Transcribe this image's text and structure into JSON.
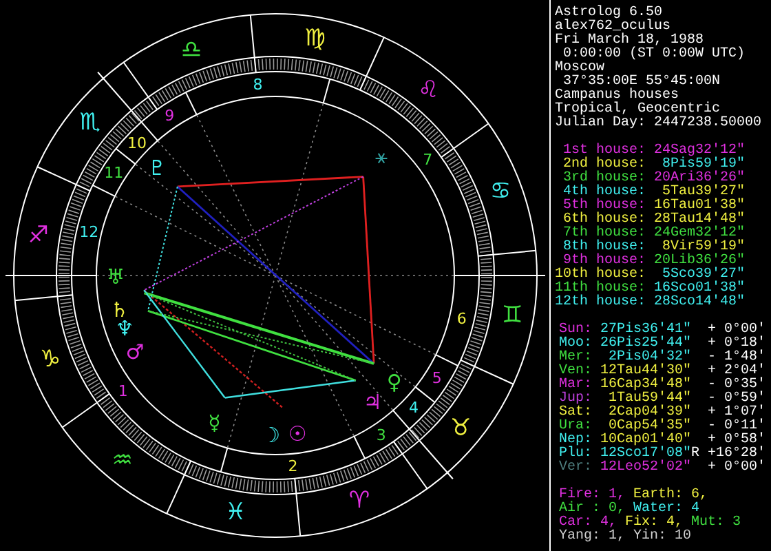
{
  "chart": {
    "signs": [
      {
        "glyph": "♈",
        "color": "#e030e0"
      },
      {
        "glyph": "♉",
        "color": "#f0f040"
      },
      {
        "glyph": "♊",
        "color": "#40e040"
      },
      {
        "glyph": "♋",
        "color": "#40f0f0"
      },
      {
        "glyph": "♌",
        "color": "#e030e0"
      },
      {
        "glyph": "♍",
        "color": "#f0f040"
      },
      {
        "glyph": "♎",
        "color": "#40e040"
      },
      {
        "glyph": "♏",
        "color": "#40f0f0"
      },
      {
        "glyph": "♐",
        "color": "#e030e0"
      },
      {
        "glyph": "♑",
        "color": "#f0f040"
      },
      {
        "glyph": "♒",
        "color": "#40e040"
      },
      {
        "glyph": "♓",
        "color": "#40f0f0"
      }
    ],
    "house_numbers": [
      {
        "text": "1",
        "color": "#e030e0"
      },
      {
        "text": "2",
        "color": "#f0f040"
      },
      {
        "text": "3",
        "color": "#40e040"
      },
      {
        "text": "4",
        "color": "#40f0f0"
      },
      {
        "text": "5",
        "color": "#e030e0"
      },
      {
        "text": "6",
        "color": "#f0f040"
      },
      {
        "text": "7",
        "color": "#40e040"
      },
      {
        "text": "8",
        "color": "#40f0f0"
      },
      {
        "text": "9",
        "color": "#e030e0"
      },
      {
        "text": "10",
        "color": "#f0f040"
      },
      {
        "text": "11",
        "color": "#40e040"
      },
      {
        "text": "12",
        "color": "#40f0f0"
      }
    ],
    "planets": [
      {
        "glyph": "☽",
        "color": "#40f0f0"
      },
      {
        "glyph": "☉",
        "color": "#e030e0"
      },
      {
        "glyph": "☿",
        "color": "#40e040"
      },
      {
        "glyph": "♀",
        "color": "#40e040"
      },
      {
        "glyph": "♂",
        "color": "#e030e0"
      },
      {
        "glyph": "♃",
        "color": "#e030e0"
      },
      {
        "glyph": "♅",
        "color": "#40e040"
      },
      {
        "glyph": "♄",
        "color": "#f0f040"
      },
      {
        "glyph": "♆",
        "color": "#40f0f0"
      },
      {
        "glyph": "♇",
        "color": "#40f0f0"
      },
      {
        "glyph": "⚹",
        "color": "#30a0a0"
      }
    ]
  },
  "info": [
    {
      "text": "Astrolog 6.50",
      "indent": false
    },
    {
      "text": "alex762_oculus",
      "indent": false
    },
    {
      "text": "Fri March 18, 1988",
      "indent": false
    },
    {
      "text": "0:00:00 (ST 0:00W UTC)",
      "indent": true
    },
    {
      "text": "Moscow",
      "indent": false
    },
    {
      "text": "37°35:00E 55°45:00N",
      "indent": true
    },
    {
      "text": "Campanus houses",
      "indent": false
    },
    {
      "text": "Tropical, Geocentric",
      "indent": false
    },
    {
      "text": "Julian Day: 2447238.50000",
      "indent": false
    }
  ],
  "houses": [
    {
      "label": {
        "text": "1st house:",
        "color": "#e030e0"
      },
      "position": {
        "text": "24Sag32'12\"",
        "color": "#e030e0"
      }
    },
    {
      "label": {
        "text": "2nd house:",
        "color": "#f0f040"
      },
      "position": {
        "text": "8Pis59'19\"",
        "color": "#40f0f0"
      }
    },
    {
      "label": {
        "text": "3rd house:",
        "color": "#40e040"
      },
      "position": {
        "text": "20Ari36'26\"",
        "color": "#e030e0"
      }
    },
    {
      "label": {
        "text": "4th house:",
        "color": "#40f0f0"
      },
      "position": {
        "text": "5Tau39'27\"",
        "color": "#f0f040"
      }
    },
    {
      "label": {
        "text": "5th house:",
        "color": "#e030e0"
      },
      "position": {
        "text": "16Tau01'38\"",
        "color": "#f0f040"
      }
    },
    {
      "label": {
        "text": "6th house:",
        "color": "#f0f040"
      },
      "position": {
        "text": "28Tau14'48\"",
        "color": "#f0f040"
      }
    },
    {
      "label": {
        "text": "7th house:",
        "color": "#40e040"
      },
      "position": {
        "text": "24Gem32'12\"",
        "color": "#40e040"
      }
    },
    {
      "label": {
        "text": "8th house:",
        "color": "#40f0f0"
      },
      "position": {
        "text": "8Vir59'19\"",
        "color": "#f0f040"
      }
    },
    {
      "label": {
        "text": "9th house:",
        "color": "#e030e0"
      },
      "position": {
        "text": "20Lib36'26\"",
        "color": "#40e040"
      }
    },
    {
      "label": {
        "text": "10th house:",
        "color": "#f0f040"
      },
      "position": {
        "text": "5Sco39'27\"",
        "color": "#40f0f0"
      }
    },
    {
      "label": {
        "text": "11th house:",
        "color": "#40e040"
      },
      "position": {
        "text": "16Sco01'38\"",
        "color": "#40f0f0"
      }
    },
    {
      "label": {
        "text": "12th house:",
        "color": "#40f0f0"
      },
      "position": {
        "text": "28Sco14'48\"",
        "color": "#40f0f0"
      }
    }
  ],
  "planets": [
    {
      "name": {
        "text": "Sun:",
        "color": "#e030e0"
      },
      "position": {
        "text": "27Pis36'41\"",
        "color": "#40f0f0"
      },
      "latitude": "+ 0°00'"
    },
    {
      "name": {
        "text": "Moo:",
        "color": "#40f0f0"
      },
      "position": {
        "text": "26Pis25'44\"",
        "color": "#40f0f0"
      },
      "latitude": "+ 0°18'"
    },
    {
      "name": {
        "text": "Mer:",
        "color": "#40e040"
      },
      "position": {
        "text": "2Pis04'32\"",
        "color": "#40f0f0"
      },
      "latitude": "- 1°48'"
    },
    {
      "name": {
        "text": "Ven:",
        "color": "#40e040"
      },
      "position": {
        "text": "12Tau44'30\"",
        "color": "#f0f040"
      },
      "latitude": "+ 2°04'"
    },
    {
      "name": {
        "text": "Mar:",
        "color": "#e030e0"
      },
      "position": {
        "text": "16Cap34'48\"",
        "color": "#f0f040"
      },
      "latitude": "- 0°35'"
    },
    {
      "name": {
        "text": "Jup:",
        "color": "#c040e0"
      },
      "position": {
        "text": "1Tau59'44\"",
        "color": "#f0f040"
      },
      "latitude": "- 0°59'"
    },
    {
      "name": {
        "text": "Sat:",
        "color": "#f0f040"
      },
      "position": {
        "text": "2Cap04'39\"",
        "color": "#f0f040"
      },
      "latitude": "+ 1°07'"
    },
    {
      "name": {
        "text": "Ura:",
        "color": "#40e040"
      },
      "position": {
        "text": "0Cap54'35\"",
        "color": "#f0f040"
      },
      "latitude": "- 0°11'"
    },
    {
      "name": {
        "text": "Nep:",
        "color": "#40f0f0"
      },
      "position": {
        "text": "10Cap01'40\"",
        "color": "#f0f040"
      },
      "latitude": "+ 0°58'"
    },
    {
      "name": {
        "text": "Plu:",
        "color": "#40f0f0"
      },
      "position": {
        "text": "12Sco17'08\"",
        "color": "#40f0f0"
      },
      "flag": "R",
      "latitude": "+16°28'"
    },
    {
      "name": {
        "text": "Ver:",
        "color": "#508080"
      },
      "position": {
        "text": "12Leo52'02\"",
        "color": "#e030e0"
      },
      "latitude": "+ 0°00'"
    }
  ],
  "balance": [
    [
      {
        "text": "Fire: 1,",
        "color": "#e030e0"
      },
      {
        "text": "Earth: 6,",
        "color": "#f0f040"
      }
    ],
    [
      {
        "text": "Air : 0,",
        "color": "#40e040"
      },
      {
        "text": "Water: 4",
        "color": "#40f0f0"
      }
    ],
    [
      {
        "text": "Car: 4,",
        "color": "#e030e0"
      },
      {
        "text": "Fix: 4,",
        "color": "#f0f040"
      },
      {
        "text": "Mut: 3",
        "color": "#40e040"
      }
    ],
    [
      {
        "text": "Yang: 1, Yin: 10",
        "color": "#d0d0d0"
      }
    ]
  ]
}
